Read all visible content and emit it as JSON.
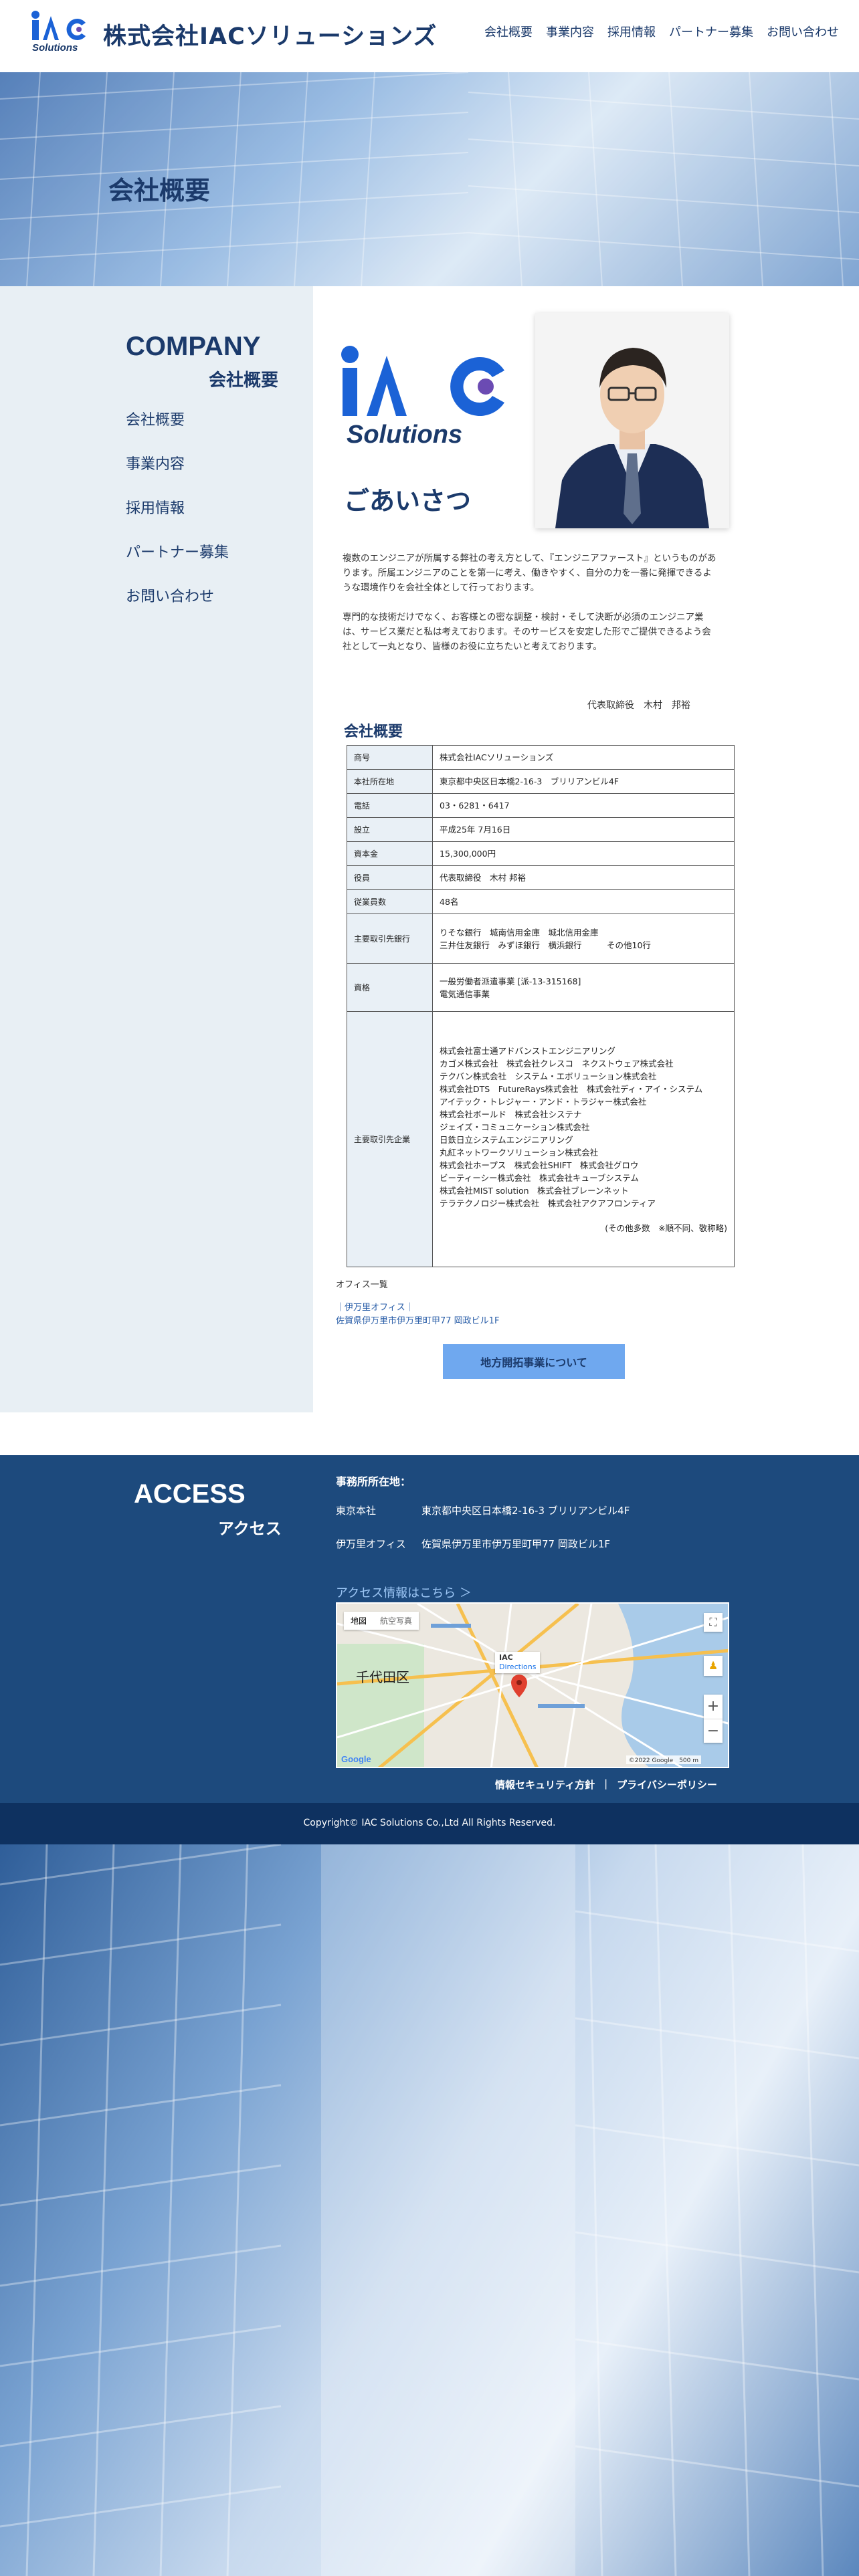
{
  "header": {
    "logo_text": "IAC",
    "logo_sub": "Solutions",
    "company_name": "株式会社IACソリューションズ",
    "nav": [
      "会社概要",
      "事業内容",
      "採用情報",
      "パートナー募集",
      "お問い合わせ"
    ]
  },
  "hero": {
    "title": "会社概要"
  },
  "sidebar": {
    "heading_en": "COMPANY",
    "heading_jp": "会社概要",
    "menu": [
      "会社概要",
      "事業内容",
      "採用情報",
      "パートナー募集",
      "お問い合わせ"
    ]
  },
  "greeting": {
    "title": "ごあいさつ",
    "para1": "複数のエンジニアが所属する弊社の考え方として、『エンジニアファースト』というものがあります。所属エンジニアのことを第一に考え、働きやすく、自分の力を一番に発揮できるような環境作りを会社全体として行っております。",
    "para2": "専門的な技術だけでなく、お客様との密な調整・検討・そして決断が必須のエンジニア業は、サービス業だと私は考えております。そのサービスを安定した形でご提供できるよう会社として一丸となり、皆様のお役に立ちたいと考えております。",
    "signature": "代表取締役　木村　邦裕"
  },
  "profile": {
    "title": "会社概要",
    "rows": [
      {
        "label": "商号",
        "value": "株式会社IACソリューションズ"
      },
      {
        "label": "本社所在地",
        "value": "東京都中央区日本橋2-16-3　ブリリアンビル4F"
      },
      {
        "label": "電話",
        "value": "03・6281・6417"
      },
      {
        "label": "設立",
        "value": "平成25年 7月16日"
      },
      {
        "label": "資本金",
        "value": "15,300,000円"
      },
      {
        "label": "役員",
        "value": "代表取締役　木村 邦裕"
      },
      {
        "label": "従業員数",
        "value": "48名"
      }
    ],
    "bank_label": "主要取引先銀行",
    "bank_line1": "りそな銀行　城南信用金庫　城北信用金庫",
    "bank_line2": "三井住友銀行　みずほ銀行　横浜銀行　　　その他10行",
    "license_label": "資格",
    "license_line1": "一般労働者派遣事業 [派-13-315168]",
    "license_line2": "電気通信事業",
    "clients_label": "主要取引先企業",
    "clients": [
      "株式会社富士通アドバンストエンジニアリング",
      "カゴメ株式会社　株式会社クレスコ　ネクストウェア株式会社",
      "テクバン株式会社　システム・エボリューション株式会社",
      "株式会社DTS　FutureRays株式会社　株式会社ディ・アイ・システム",
      "アイテック・トレジャー・アンド・トラジャー株式会社",
      "株式会社ボールド　株式会社システナ",
      "ジェイズ・コミュニケーション株式会社",
      "日鉄日立システムエンジニアリング",
      "丸紅ネットワークソリューション株式会社",
      "株式会社ホープス　株式会社SHIFT　株式会社グロウ",
      "ビーティーシー株式会社　株式会社キューブシステム",
      "株式会社MIST solution　株式会社ブレーンネット",
      "テラテクノロジー株式会社　株式会社アクアフロンティア"
    ],
    "clients_note": "(その他多数　※順不同、敬称略)"
  },
  "office": {
    "label": "オフィス一覧",
    "imari_name": "｜伊万里オフィス｜",
    "imari_address": "佐賀県伊万里市伊万里町甲77 岡政ビル1F",
    "button": "地方開拓事業について"
  },
  "access": {
    "heading_en": "ACCESS",
    "heading_jp": "アクセス",
    "head": "事務所所在地：",
    "tokyo_label": "東京本社",
    "tokyo_address": "東京都中央区日本橋2-16-3 ブリリアンビル4F",
    "imari_label": "伊万里オフィス",
    "imari_address": "佐賀県伊万里市伊万里町甲77 岡政ビル1F",
    "more_link": "アクセス情報はこちら ＞",
    "map": {
      "tab_map": "地図",
      "tab_sat": "航空写真",
      "area_label": "千代田区",
      "pin_title": "IAC",
      "directions": "Directions",
      "attribution": "©2022 Google　500 m"
    }
  },
  "footer": {
    "policy1": "情報セキュリティ方針",
    "sep": "|",
    "policy2": "プライバシーポリシー",
    "copyright": "Copyright© IAC Solutions Co.,Ltd All Rights Reserved."
  },
  "colors": {
    "navy": "#1b3a6b",
    "access_bg": "#1d4a7d",
    "copyright_bg": "#0e3160",
    "sidebar_bg": "#e8eff4",
    "button": "#6fa8ef"
  }
}
